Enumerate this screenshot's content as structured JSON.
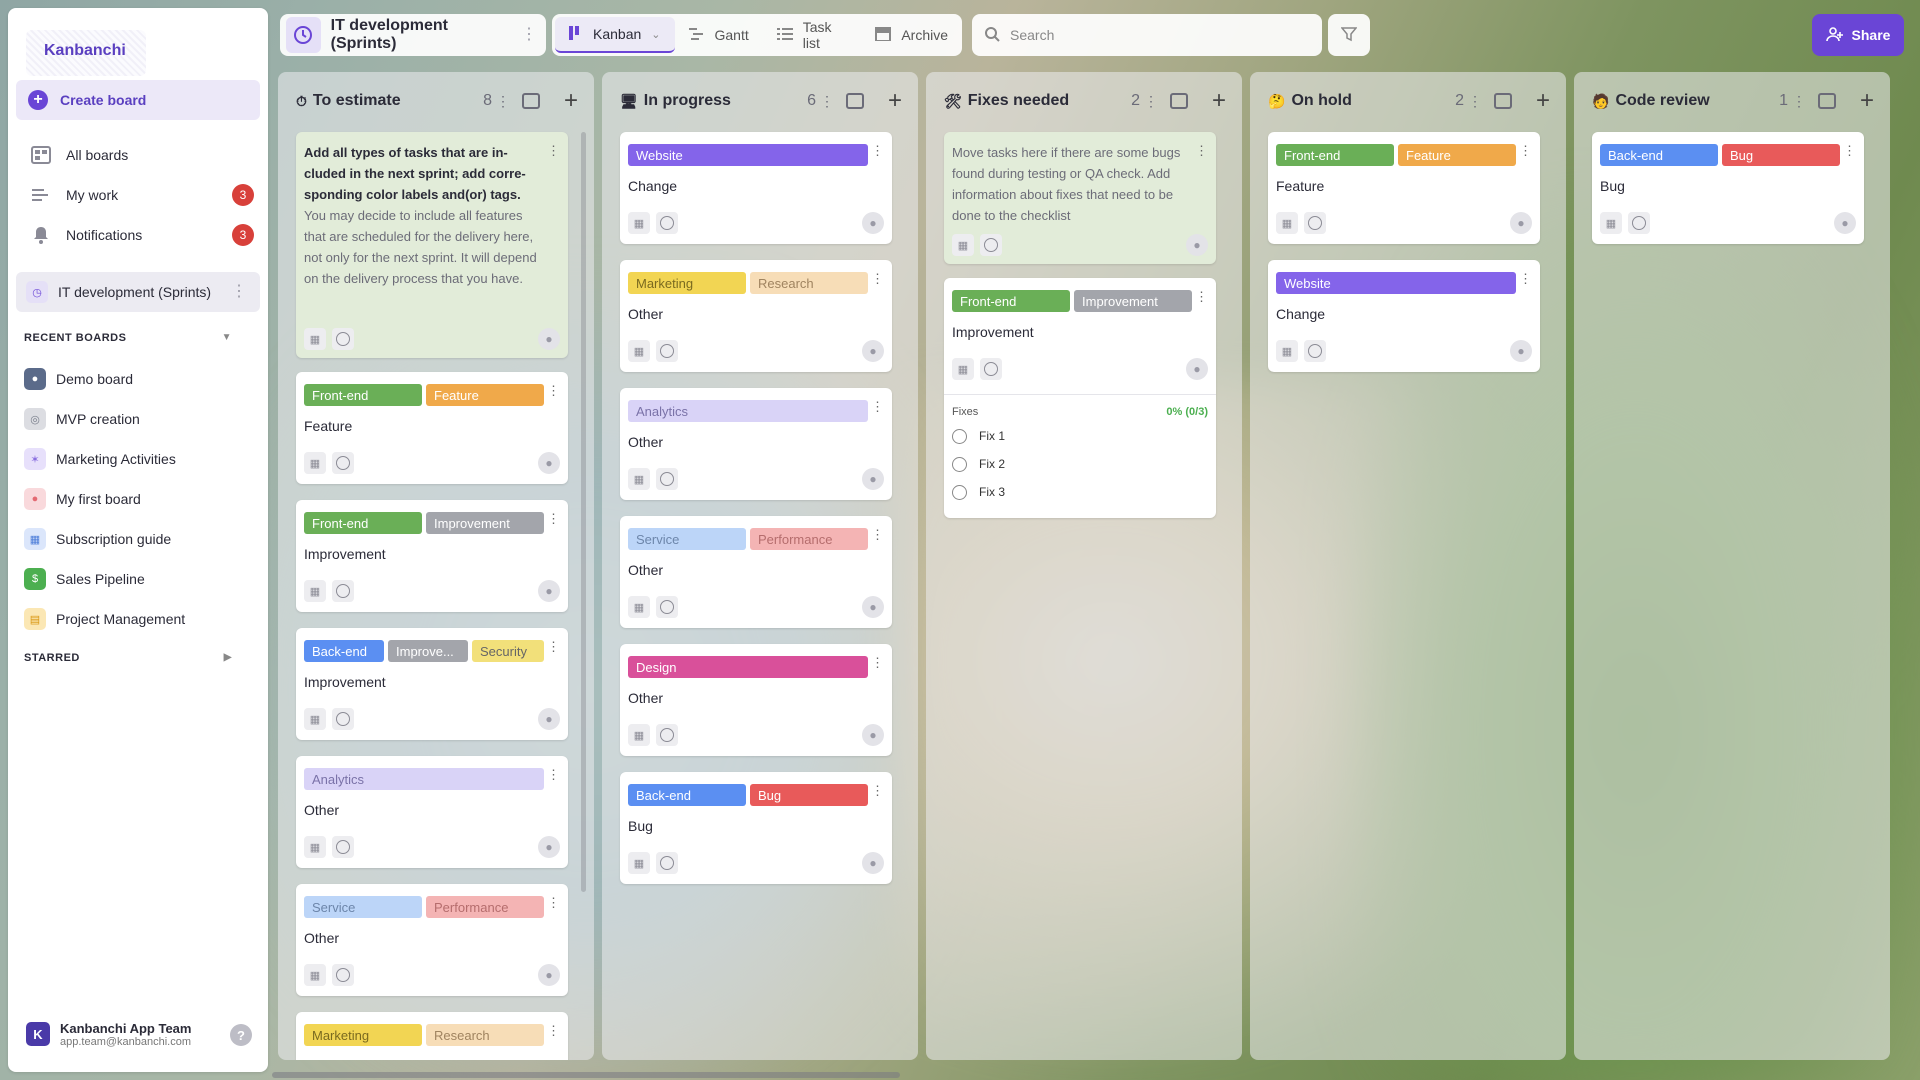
{
  "app": {
    "name": "Kanbanchi"
  },
  "sidebar": {
    "create_board": "Create board",
    "items": [
      {
        "label": "All boards",
        "icon": "boards-icon",
        "badge": ""
      },
      {
        "label": "My work",
        "icon": "my-work-icon",
        "badge": "3"
      },
      {
        "label": "Notifications",
        "icon": "bell-icon",
        "badge": "3"
      }
    ],
    "current_board": "IT development (Sprints)",
    "recent_title": "RECENT BOARDS",
    "recent": [
      {
        "label": "Demo board",
        "color": "#5b6b8a"
      },
      {
        "label": "MVP creation",
        "color": "#7a7f8c"
      },
      {
        "label": "Marketing Activities",
        "color": "#8a6fe0"
      },
      {
        "label": "My first board",
        "color": "#e46a73"
      },
      {
        "label": "Subscription guide",
        "color": "#4a7bd8"
      },
      {
        "label": "Sales Pipeline",
        "color": "#4caf50"
      },
      {
        "label": "Project Management",
        "color": "#f0b429"
      }
    ],
    "starred_title": "STARRED",
    "user": {
      "name": "Kanbanchi App Team",
      "email": "app.team@kanbanchi.com",
      "initial": "K"
    }
  },
  "topbar": {
    "board_title": "IT development (Sprints)",
    "views": [
      "Kanban",
      "Gantt",
      "Task list",
      "Archive"
    ],
    "search_placeholder": "Search",
    "share": "Share"
  },
  "columns": [
    {
      "title": "To estimate",
      "emoji": "⏱",
      "count": "8",
      "note": {
        "bold": "Add all types of tasks that are in-cluded in the next sprint; add corre-sponding color labels and(or) tags.",
        "muted": "You may decide to include all features that are scheduled for the delivery here, not only for the next sprint. It will depend on the delivery process that you have."
      },
      "cards": [
        {
          "labels": [
            [
              "Front-end",
              "#6aaf57",
              "#fff"
            ],
            [
              "Feature",
              "#f0a94a",
              "#fff"
            ]
          ],
          "title": "Feature"
        },
        {
          "labels": [
            [
              "Front-end",
              "#6aaf57",
              "#fff"
            ],
            [
              "Improvement",
              "#a3a5ab",
              "#fff"
            ]
          ],
          "title": "Improvement"
        },
        {
          "labels": [
            [
              "Back-end",
              "#5b8ff2",
              "#fff"
            ],
            [
              "Improve...",
              "#a3a5ab",
              "#fff"
            ],
            [
              "Security",
              "#f2e07a",
              "#666"
            ]
          ],
          "title": "Improvement"
        },
        {
          "labels": [
            [
              "Analytics",
              "#d9d3f7",
              "#7a72a8"
            ]
          ],
          "title": "Other"
        },
        {
          "labels": [
            [
              "Service",
              "#bcd5f8",
              "#6d86aa"
            ],
            [
              "Performance",
              "#f4b4b4",
              "#b56d6d"
            ]
          ],
          "title": "Other"
        },
        {
          "labels": [
            [
              "Marketing",
              "#f2d553",
              "#7a6a20"
            ],
            [
              "Research",
              "#f7ddb7",
              "#a08460"
            ]
          ],
          "title": ""
        }
      ]
    },
    {
      "title": "In progress",
      "emoji": "🖥",
      "count": "6",
      "cards": [
        {
          "labels": [
            [
              "Website",
              "#8464ea",
              "#fff"
            ]
          ],
          "title": "Change"
        },
        {
          "labels": [
            [
              "Marketing",
              "#f2d553",
              "#7a6a20"
            ],
            [
              "Research",
              "#f7ddb7",
              "#a08460"
            ]
          ],
          "title": "Other"
        },
        {
          "labels": [
            [
              "Analytics",
              "#d9d3f7",
              "#7a72a8"
            ]
          ],
          "title": "Other"
        },
        {
          "labels": [
            [
              "Service",
              "#bcd5f8",
              "#6d86aa"
            ],
            [
              "Performance",
              "#f4b4b4",
              "#b56d6d"
            ]
          ],
          "title": "Other"
        },
        {
          "labels": [
            [
              "Design",
              "#d9509a",
              "#fff"
            ]
          ],
          "title": "Other"
        },
        {
          "labels": [
            [
              "Back-end",
              "#5b8ff2",
              "#fff"
            ],
            [
              "Bug",
              "#e85a5a",
              "#fff"
            ]
          ],
          "title": "Bug"
        }
      ]
    },
    {
      "title": "Fixes needed",
      "emoji": "🛠",
      "count": "2",
      "note": {
        "bold": "",
        "muted": "Move tasks here if there are some bugs found during testing or QA check. Add information about fixes that need to be done to the checklist"
      },
      "cards": [
        {
          "labels": [
            [
              "Front-end",
              "#6aaf57",
              "#fff"
            ],
            [
              "Improvement",
              "#a3a5ab",
              "#fff"
            ]
          ],
          "title": "Improvement",
          "checklist": {
            "title": "Fixes",
            "progress": "0% (0/3)",
            "items": [
              "Fix 1",
              "Fix 2",
              "Fix 3"
            ]
          }
        }
      ]
    },
    {
      "title": "On hold",
      "emoji": "🤔",
      "count": "2",
      "cards": [
        {
          "labels": [
            [
              "Front-end",
              "#6aaf57",
              "#fff"
            ],
            [
              "Feature",
              "#f0a94a",
              "#fff"
            ]
          ],
          "title": "Feature"
        },
        {
          "labels": [
            [
              "Website",
              "#8464ea",
              "#fff"
            ]
          ],
          "title": "Change"
        }
      ]
    },
    {
      "title": "Code review",
      "emoji": "🧑",
      "count": "1",
      "cards": [
        {
          "labels": [
            [
              "Back-end",
              "#5b8ff2",
              "#fff"
            ],
            [
              "Bug",
              "#e85a5a",
              "#fff"
            ]
          ],
          "title": "Bug"
        }
      ]
    }
  ]
}
